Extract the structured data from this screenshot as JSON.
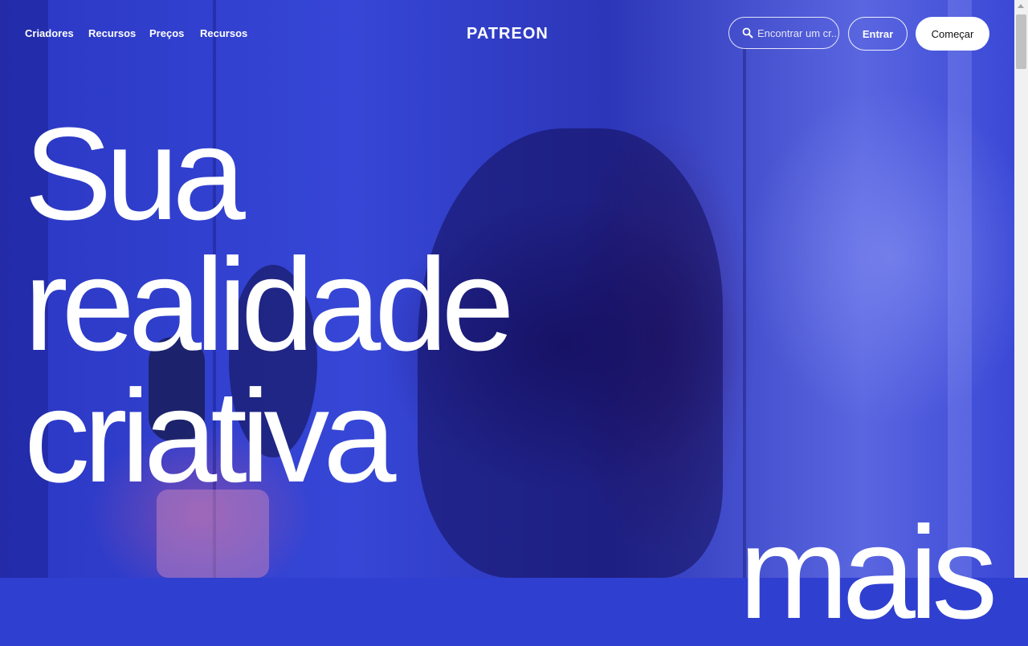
{
  "nav": {
    "links": [
      "Criadores",
      "Recursos",
      "Preços",
      "Recursos"
    ],
    "logo": "PATREON",
    "search_placeholder": "Encontrar um cr...",
    "login_label": "Entrar",
    "start_label": "Começar"
  },
  "hero": {
    "headline_lines": [
      "Sua",
      "realidade",
      "criativa",
      "mais"
    ]
  },
  "icons": {
    "search": "search-icon"
  },
  "colors": {
    "background": "#2f3fd0",
    "text": "#ffffff",
    "start_button_bg": "#ffffff"
  }
}
